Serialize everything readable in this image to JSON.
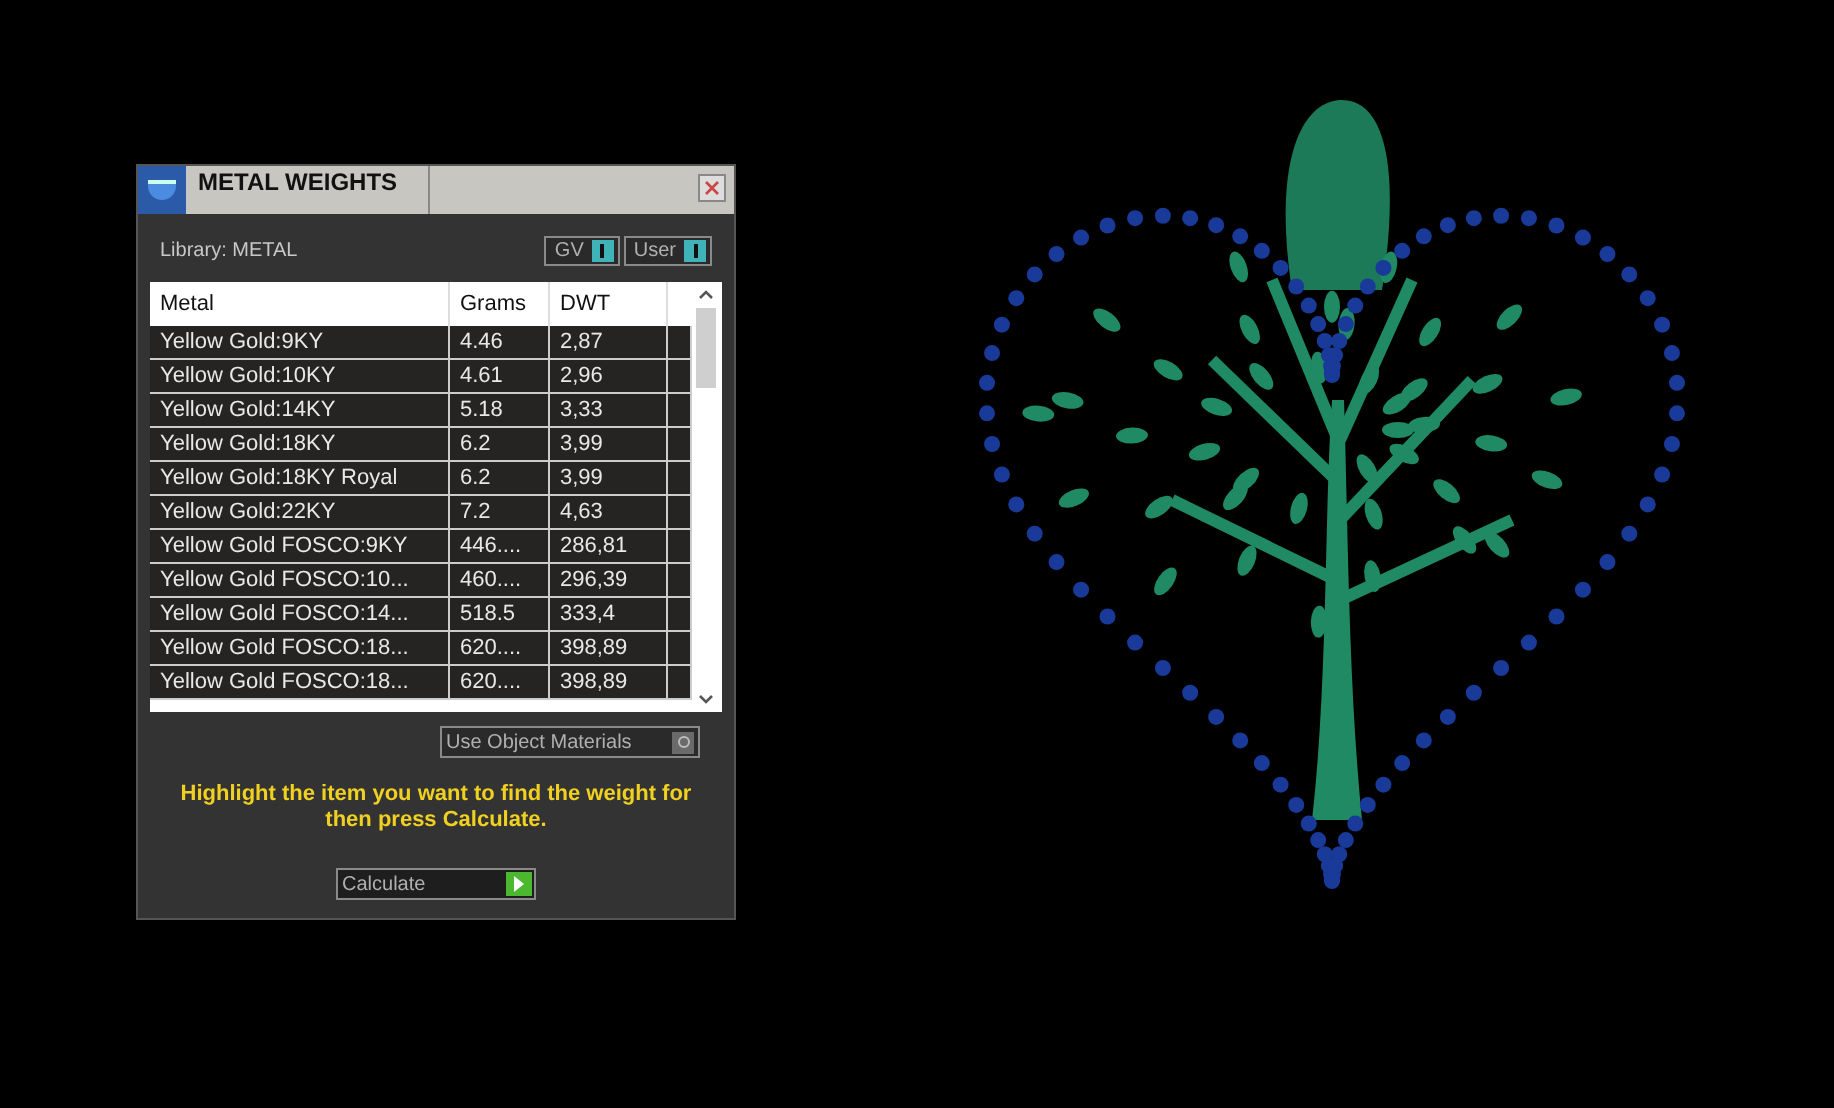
{
  "panel": {
    "title": "METAL WEIGHTS",
    "library_label": "Library: METAL",
    "toggles": [
      {
        "label": "GV",
        "on": true
      },
      {
        "label": "User",
        "on": true
      }
    ],
    "table": {
      "columns": [
        "Metal",
        "Grams",
        "DWT"
      ],
      "rows": [
        {
          "cells": [
            "Yellow Gold:9KY",
            "4.46",
            "2,87"
          ],
          "selected": false
        },
        {
          "cells": [
            "Yellow Gold:10KY",
            "4.61",
            "2,96"
          ],
          "selected": false
        },
        {
          "cells": [
            "Yellow Gold:14KY",
            "5.18",
            "3,33"
          ],
          "selected": false
        },
        {
          "cells": [
            "Yellow Gold:18KY",
            "6.2",
            "3,99"
          ],
          "selected": false
        },
        {
          "cells": [
            "Yellow Gold:18KY Royal",
            "6.2",
            "3,99"
          ],
          "selected": false
        },
        {
          "cells": [
            "Yellow Gold:22KY",
            "7.2",
            "4,63"
          ],
          "selected": false
        },
        {
          "cells": [
            "Yellow Gold FOSCO:9KY",
            "446....",
            "286,81"
          ],
          "selected": false
        },
        {
          "cells": [
            "Yellow Gold FOSCO:10...",
            "460....",
            "296,39"
          ],
          "selected": false
        },
        {
          "cells": [
            "Yellow Gold FOSCO:14...",
            "518.5",
            "333,4"
          ],
          "selected": false
        },
        {
          "cells": [
            "Yellow Gold FOSCO:18...",
            "620....",
            "398,89"
          ],
          "selected": false
        },
        {
          "cells": [
            "Yellow Gold FOSCO:18...",
            "620....",
            "398,89"
          ],
          "selected": false
        }
      ]
    },
    "use_object_materials": {
      "label": "Use Object Materials",
      "on": false
    },
    "instruction": "Highlight the item you want to find the weight for then press Calculate.",
    "calculate_button": "Calculate"
  }
}
